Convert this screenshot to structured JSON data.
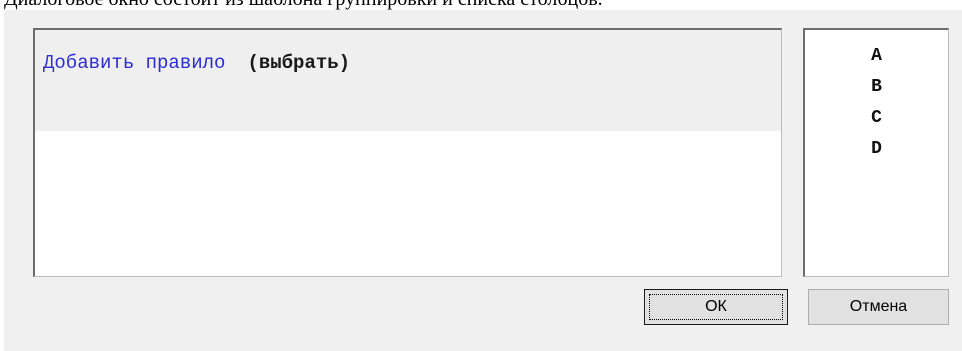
{
  "caption": "Диалоговое окно состоит из шаблона группировки и списка столбцов.",
  "rule_editor": {
    "add_rule_link": "Добавить правило",
    "choose_label": "(выбрать)"
  },
  "columns": {
    "items": [
      "A",
      "B",
      "C",
      "D"
    ]
  },
  "buttons": {
    "ok_label": "ОК",
    "cancel_label": "Отмена"
  }
}
